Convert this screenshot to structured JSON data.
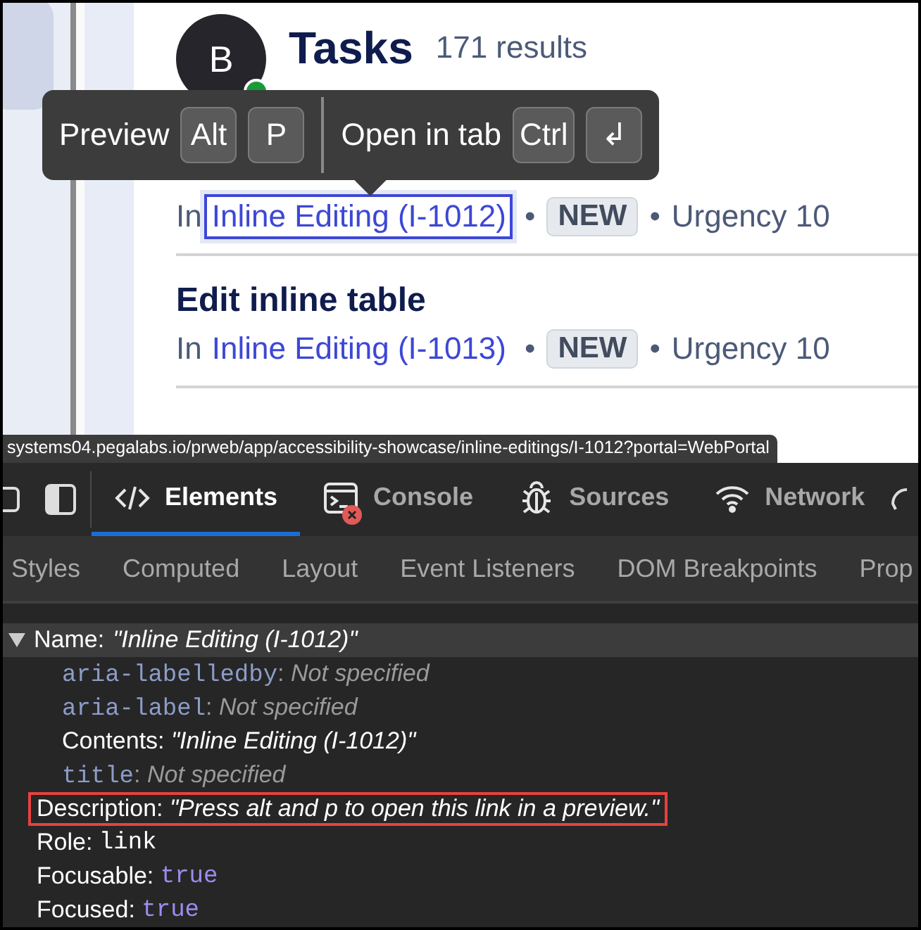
{
  "page": {
    "avatar": {
      "initial": "B",
      "online": true
    },
    "title": "Tasks",
    "count": "171 results",
    "tasks": [
      {
        "prefix": "In",
        "link": "Inline Editing (I-1012)",
        "bullets": [
          "•",
          "•"
        ],
        "status": "NEW",
        "urgency": "Urgency 10",
        "focused": true
      },
      {
        "title": "Edit inline table",
        "prefix": "In",
        "link": "Inline Editing (I-1013)",
        "bullets": [
          "•",
          "•"
        ],
        "status": "NEW",
        "urgency": "Urgency 10",
        "focused": false
      }
    ]
  },
  "tooltip": {
    "items": [
      {
        "label": "Preview",
        "keys": [
          "Alt",
          "P"
        ]
      },
      {
        "label": "Open in tab",
        "keys": [
          "Ctrl",
          "↲"
        ]
      }
    ]
  },
  "status_url": "systems04.pegalabs.io/prweb/app/accessibility-showcase/inline-editings/I-1012?portal=WebPortal",
  "devtools": {
    "tabs": [
      {
        "label": "Elements",
        "selected": true,
        "error": false
      },
      {
        "label": "Console",
        "selected": false,
        "error": true
      },
      {
        "label": "Sources",
        "selected": false,
        "error": false
      },
      {
        "label": "Network",
        "selected": false,
        "error": false
      }
    ],
    "subtabs": [
      "Styles",
      "Computed",
      "Layout",
      "Event Listeners",
      "DOM Breakpoints",
      "Prop"
    ],
    "name_row": {
      "label": "Name:",
      "value": "\"Inline Editing (I-1012)\"",
      "expanded": true,
      "children": [
        {
          "kind": "attribute",
          "key": "aria-labelledby:",
          "value": "Not specified",
          "highlighted": false
        },
        {
          "kind": "attribute",
          "key": "aria-label:",
          "value": "Not specified",
          "highlighted": false
        },
        {
          "kind": "string",
          "key": "Contents:",
          "value": "\"Inline Editing (I-1012)\"",
          "highlighted": false
        },
        {
          "kind": "attribute",
          "key": "title:",
          "value": "Not specified",
          "highlighted": false
        }
      ]
    },
    "properties": [
      {
        "kind": "string",
        "key": "Description:",
        "value": "\"Press alt and p to open this link in a preview.\"",
        "highlighted": true
      },
      {
        "kind": "keyword",
        "key": "Role:",
        "value": "link",
        "highlighted": false
      },
      {
        "kind": "boolean",
        "key": "Focusable:",
        "value": "true",
        "highlighted": false
      },
      {
        "kind": "boolean",
        "key": "Focused:",
        "value": "true",
        "highlighted": false
      }
    ]
  }
}
